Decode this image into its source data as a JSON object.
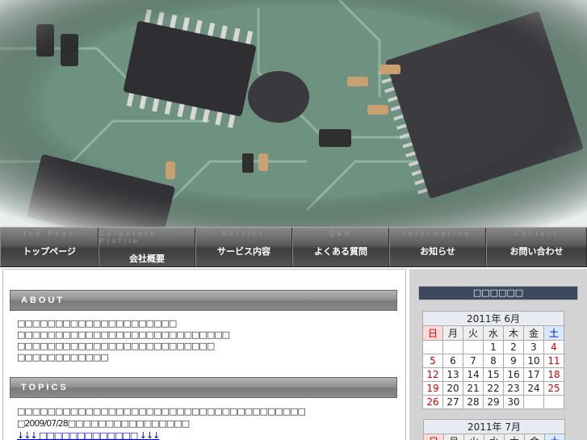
{
  "nav": [
    {
      "en": "Top Page",
      "jp": "トップページ"
    },
    {
      "en": "Corporate Profile",
      "jp": "会社概要"
    },
    {
      "en": "Service",
      "jp": "サービス内容"
    },
    {
      "en": "Q&A",
      "jp": "よくある質問"
    },
    {
      "en": "Information",
      "jp": "お知らせ"
    },
    {
      "en": "Contact",
      "jp": "お問い合わせ"
    }
  ],
  "about": {
    "heading": "ABOUT",
    "lines": [
      "□□□□□□□□□□□□□□□□□□□□□",
      "□□□□□□□□□□□□□□□□□□□□□□□□□□□□",
      "□□□□□□□□□□□□□□□□□□□□□□□□□□",
      "□□□□□□□□□□□□"
    ]
  },
  "topics": {
    "heading": "TOPICS",
    "line1": "□□□□□□□□□□□□□□□□□□□□□□□□□□□□□□□□□□□□□□",
    "line2": "□2009/07/28□□□□□□□□□□□□□□□□",
    "link": "↓↓↓ □□□□□□□□□□□□□ ↓↓↓"
  },
  "sidebar": {
    "calendar_title": "□□□□□□",
    "weekdays": [
      "日",
      "月",
      "火",
      "水",
      "木",
      "金",
      "土"
    ],
    "june": {
      "caption": "2011年  6月",
      "rows": [
        [
          "",
          "",
          "",
          "1",
          "2",
          "3",
          "4"
        ],
        [
          "5",
          "6",
          "7",
          "8",
          "9",
          "10",
          "11"
        ],
        [
          "12",
          "13",
          "14",
          "15",
          "16",
          "17",
          "18"
        ],
        [
          "19",
          "20",
          "21",
          "22",
          "23",
          "24",
          "25"
        ],
        [
          "26",
          "27",
          "28",
          "29",
          "30",
          "",
          ""
        ]
      ],
      "today": "21"
    },
    "july": {
      "caption": "2011年  7月"
    }
  },
  "colors": {
    "nav_bg": "#4a4a4a",
    "sidebar_bg": "#d3d3d3",
    "calendar_title_bg": "#3d4a5e",
    "sunday": "#dd0000",
    "saturday": "#0000cc",
    "link": "#0000cc"
  }
}
